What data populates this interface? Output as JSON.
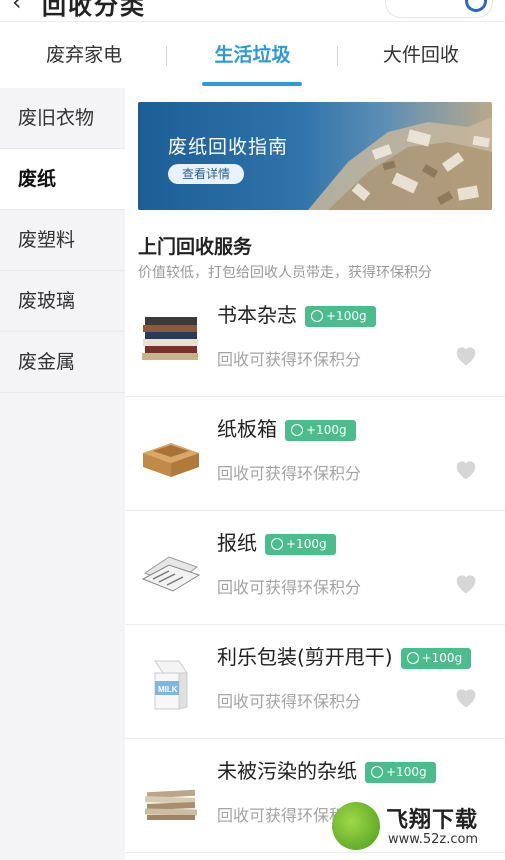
{
  "header": {
    "title": "回收分类"
  },
  "tabs": [
    {
      "label": "废弃家电"
    },
    {
      "label": "生活垃圾"
    },
    {
      "label": "大件回收"
    }
  ],
  "sidebar": {
    "items": [
      {
        "label": "废旧衣物"
      },
      {
        "label": "废纸"
      },
      {
        "label": "废塑料"
      },
      {
        "label": "废玻璃"
      },
      {
        "label": "废金属"
      }
    ]
  },
  "banner": {
    "title": "废纸回收指南",
    "button": "查看详情"
  },
  "section": {
    "title": "上门回收服务",
    "subtitle": "价值较低，打包给回收人员带走，获得环保积分"
  },
  "items": [
    {
      "name": "书本杂志",
      "badge": "+100g",
      "sub": "回收可获得环保积分"
    },
    {
      "name": "纸板箱",
      "badge": "+100g",
      "sub": "回收可获得环保积分"
    },
    {
      "name": "报纸",
      "badge": "+100g",
      "sub": "回收可获得环保积分"
    },
    {
      "name": "利乐包装(剪开甩干)",
      "badge": "+100g",
      "sub": "回收可获得环保积分"
    },
    {
      "name": "未被污染的杂纸",
      "badge": "+100g",
      "sub": "回收可获得环保积"
    }
  ],
  "watermark": {
    "text": "飞翔下载",
    "url": "www.52z.com"
  },
  "colors": {
    "accent": "#2c9ad8",
    "badge": "#4bbc8c",
    "heart": "#d6d6d6"
  }
}
